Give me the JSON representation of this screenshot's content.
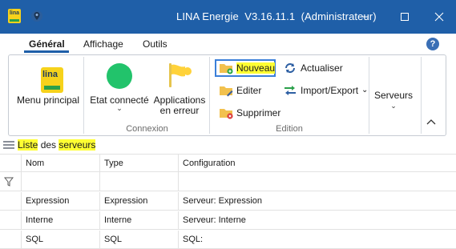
{
  "window": {
    "title": "LINA Energie  V3.16.11.1  (Administrateur)",
    "logo_text": "lina",
    "logo_sub": "Energie"
  },
  "tabs": [
    {
      "label": "Général",
      "active": true
    },
    {
      "label": "Affichage",
      "active": false
    },
    {
      "label": "Outils",
      "active": false
    }
  ],
  "help": {
    "label": "?"
  },
  "ribbon": {
    "menu_principal": {
      "label": "Menu principal"
    },
    "connexion": {
      "group_label": "Connexion",
      "etat": {
        "label": "Etat connecté",
        "chevron": "⌄"
      },
      "applications": {
        "label_line1": "Applications",
        "label_line2": "en erreur"
      }
    },
    "edition": {
      "group_label": "Edition",
      "nouveau": {
        "label": "Nouveau"
      },
      "editer": {
        "label": "Editer"
      },
      "supprimer": {
        "label": "Supprimer"
      },
      "actualiser": {
        "label": "Actualiser"
      },
      "import_export": {
        "label": "Import/Export",
        "chevron": "⌄"
      }
    },
    "serveurs": {
      "label": "Serveurs",
      "chevron": "⌄"
    }
  },
  "list": {
    "title_part1": "Liste",
    "title_part2": " des ",
    "title_part3": "serveurs"
  },
  "table": {
    "columns": [
      "Nom",
      "Type",
      "Configuration"
    ],
    "rows": [
      {
        "nom": "Expression",
        "type": "Expression",
        "configuration": "Serveur: Expression"
      },
      {
        "nom": "Interne",
        "type": "Interne",
        "configuration": "Serveur: Interne"
      },
      {
        "nom": "SQL",
        "type": "SQL",
        "configuration": "SQL:"
      }
    ]
  },
  "colors": {
    "titlebar": "#1f5fa8",
    "accent": "#3b7fd9",
    "highlight": "#ffff33",
    "status_green": "#22c36b",
    "brand_yellow": "#f6d21b"
  }
}
